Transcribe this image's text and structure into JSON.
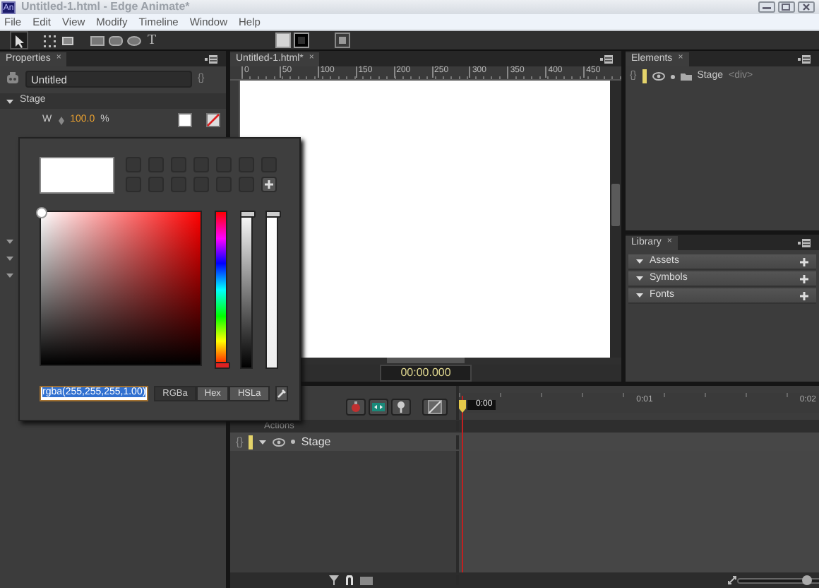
{
  "window": {
    "app_icon": "An",
    "title": "Untitled-1.html - Edge Animate*"
  },
  "menu": [
    "File",
    "Edit",
    "View",
    "Modify",
    "Timeline",
    "Window",
    "Help"
  ],
  "tools": [
    {
      "kind": "pointer",
      "selected": true
    },
    {
      "kind": "transform",
      "selected": false
    },
    {
      "kind": "clip",
      "selected": false
    },
    {
      "kind": "rectangle",
      "selected": false
    },
    {
      "kind": "rounded",
      "selected": false
    },
    {
      "kind": "ellipse",
      "selected": false
    },
    {
      "kind": "text",
      "glyph": "T",
      "selected": false
    }
  ],
  "properties": {
    "tab": {
      "label": "Properties",
      "close": "×"
    },
    "name_value": "Untitled",
    "code_glyph": "{}",
    "section": "Stage",
    "w_label": "W",
    "w_value": "100.0",
    "w_unit": "%"
  },
  "stage_panel": {
    "tab": {
      "label": "Untitled-1.html*",
      "close": "×"
    },
    "ruler": [
      "0",
      "50",
      "100",
      "150",
      "200",
      "250",
      "300",
      "350",
      "400",
      "450"
    ],
    "time": "00:00.000"
  },
  "elements": {
    "tab": {
      "label": "Elements",
      "close": "×"
    },
    "rows": [
      {
        "glyph": "{}",
        "name": "Stage",
        "tag": "<div>"
      }
    ]
  },
  "library": {
    "tab": {
      "label": "Library",
      "close": "×"
    },
    "sections": [
      "Assets",
      "Symbols",
      "Fonts"
    ]
  },
  "timeline": {
    "header_label": "Actions",
    "layers": [
      {
        "glyph": "{}",
        "name": "Stage"
      }
    ],
    "ticks": [
      "0:00",
      "0:01",
      "0:02"
    ],
    "zoom": {
      "level": 0.72
    }
  },
  "color_picker": {
    "value": "rgba(255,255,255,1.00)",
    "hue": {
      "level": 0
    },
    "lightness": {
      "level": 1
    },
    "alpha": {
      "level": 1
    },
    "modes": [
      {
        "label": "RGBa",
        "selected": true
      },
      {
        "label": "Hex",
        "selected": false
      },
      {
        "label": "HSLa",
        "selected": false
      }
    ]
  }
}
